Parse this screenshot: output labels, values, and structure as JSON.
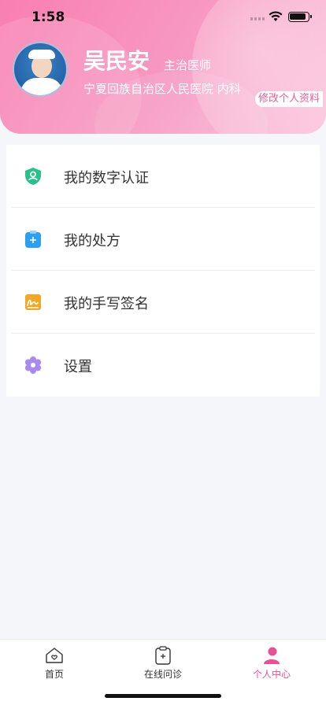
{
  "status_bar": {
    "time": "1:58"
  },
  "profile": {
    "name": "吴民安",
    "title": "主治医师",
    "hospital": "宁夏回族自治区人民医院 内科",
    "edit_label": "修改个人资料"
  },
  "menu": {
    "items": [
      {
        "label": "我的数字认证",
        "icon": "shield-user-icon"
      },
      {
        "label": "我的处方",
        "icon": "prescription-clipboard-icon"
      },
      {
        "label": "我的手写签名",
        "icon": "signature-icon"
      },
      {
        "label": "设置",
        "icon": "gear-icon"
      }
    ]
  },
  "tabbar": {
    "tabs": [
      {
        "label": "首页",
        "icon": "home-icon"
      },
      {
        "label": "在线问诊",
        "icon": "consult-clipboard-icon"
      },
      {
        "label": "个人中心",
        "icon": "user-icon"
      }
    ],
    "active_index": 2
  },
  "colors": {
    "accent": "#ec4f93",
    "header_start": "#f97fb1",
    "header_end": "#fbc3dc"
  }
}
